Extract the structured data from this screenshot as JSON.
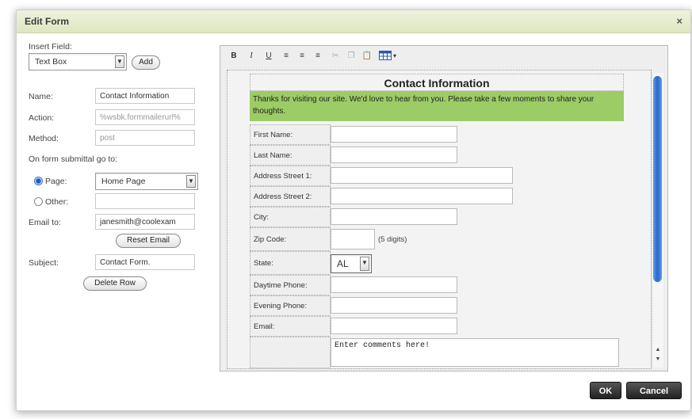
{
  "dialog": {
    "title": "Edit Form",
    "close_glyph": "×"
  },
  "left": {
    "insert_field_label": "Insert Field:",
    "insert_field_value": "Text Box",
    "add_button": "Add",
    "name_label": "Name:",
    "name_value": "Contact Information",
    "action_label": "Action:",
    "action_value": "%wsbk.formmailerurl%",
    "method_label": "Method:",
    "method_value": "post",
    "on_submit_label": "On form submittal go to:",
    "page_radio_label": "Page:",
    "page_value": "Home Page",
    "other_radio_label": "Other:",
    "other_value": "",
    "email_label": "Email to:",
    "email_value": "janesmith@coolexam",
    "reset_email_button": "Reset Email",
    "subject_label": "Subject:",
    "subject_value": "Contact Form.",
    "delete_row_button": "Delete Row"
  },
  "toolbar": {
    "bold": "B",
    "italic": "I",
    "underline": "U",
    "align_left": "≡",
    "align_center": "≡",
    "align_right": "≡",
    "cut": "✂",
    "copy": "❐",
    "paste": "📋",
    "table_arrow": "▾"
  },
  "form": {
    "heading": "Contact Information",
    "intro": "Thanks for visiting our site. We'd love to hear from you. Please take a few moments to share your thoughts.",
    "rows": {
      "first_name": "First Name:",
      "last_name": "Last Name:",
      "address1": "Address Street 1:",
      "address2": "Address Street 2:",
      "city": "City:",
      "zip": "Zip Code:",
      "zip_hint": "(5 digits)",
      "state": "State:",
      "state_value": "AL",
      "day_phone": "Daytime Phone:",
      "eve_phone": "Evening Phone:",
      "email": "Email:"
    },
    "comments_placeholder": "Enter comments here!"
  },
  "footer": {
    "ok": "OK",
    "cancel": "Cancel"
  },
  "colors": {
    "titlebar": "#dde7bf",
    "intro_bg": "#9ccc65",
    "scroll_thumb": "#2a66c8"
  }
}
